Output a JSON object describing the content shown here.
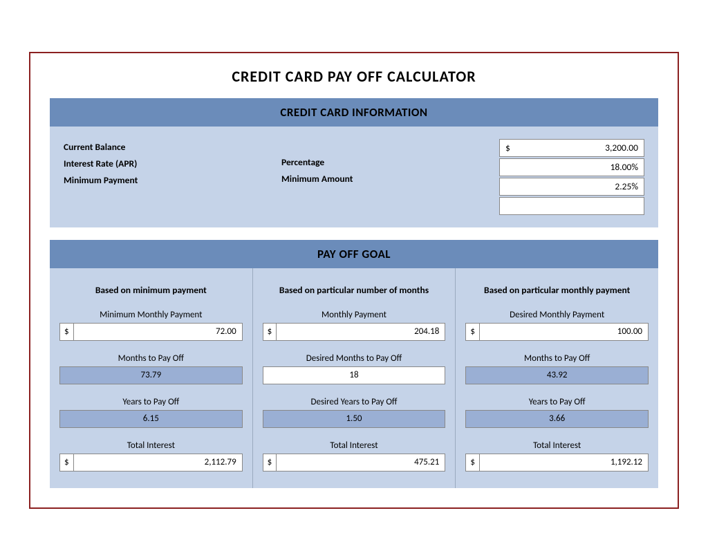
{
  "title": "CREDIT CARD PAY OFF CALCULATOR",
  "sections": {
    "credit_card_info": {
      "header": "CREDIT CARD INFORMATION",
      "labels": {
        "current_balance": "Current Balance",
        "interest_rate": "Interest Rate (APR)",
        "minimum_payment": "Minimum Payment",
        "percentage": "Percentage",
        "minimum_amount": "Minimum Amount"
      },
      "values": {
        "dollar_sign": "$",
        "current_balance": "3,200.00",
        "interest_rate": "18.00%",
        "minimum_payment_pct": "2.25%",
        "minimum_amount": ""
      }
    },
    "payoff_goal": {
      "header": "PAY OFF GOAL",
      "columns": [
        {
          "header": "Based on minimum payment",
          "fields": [
            {
              "label": "Minimum Monthly Payment",
              "type": "dollar-input",
              "dollar": "$",
              "value": "72.00"
            },
            {
              "label": "Months to Pay Off",
              "type": "result-blue",
              "value": "73.79"
            },
            {
              "label": "Years to Pay Off",
              "type": "result-blue",
              "value": "6.15"
            },
            {
              "label": "Total Interest",
              "type": "dollar-input",
              "dollar": "$",
              "value": "2,112.79"
            }
          ]
        },
        {
          "header": "Based on particular number of months",
          "fields": [
            {
              "label": "Monthly Payment",
              "type": "dollar-input",
              "dollar": "$",
              "value": "204.18"
            },
            {
              "label": "Desired Months to Pay Off",
              "type": "result-white",
              "value": "18"
            },
            {
              "label": "Desired Years to Pay Off",
              "type": "result-blue",
              "value": "1.50"
            },
            {
              "label": "Total Interest",
              "type": "dollar-input",
              "dollar": "$",
              "value": "475.21"
            }
          ]
        },
        {
          "header": "Based on particular monthly payment",
          "fields": [
            {
              "label": "Desired Monthly Payment",
              "type": "dollar-input",
              "dollar": "$",
              "value": "100.00"
            },
            {
              "label": "Months to Pay Off",
              "type": "result-blue",
              "value": "43.92"
            },
            {
              "label": "Years to Pay Off",
              "type": "result-blue",
              "value": "3.66"
            },
            {
              "label": "Total Interest",
              "type": "dollar-input",
              "dollar": "$",
              "value": "1,192.12"
            }
          ]
        }
      ]
    }
  }
}
